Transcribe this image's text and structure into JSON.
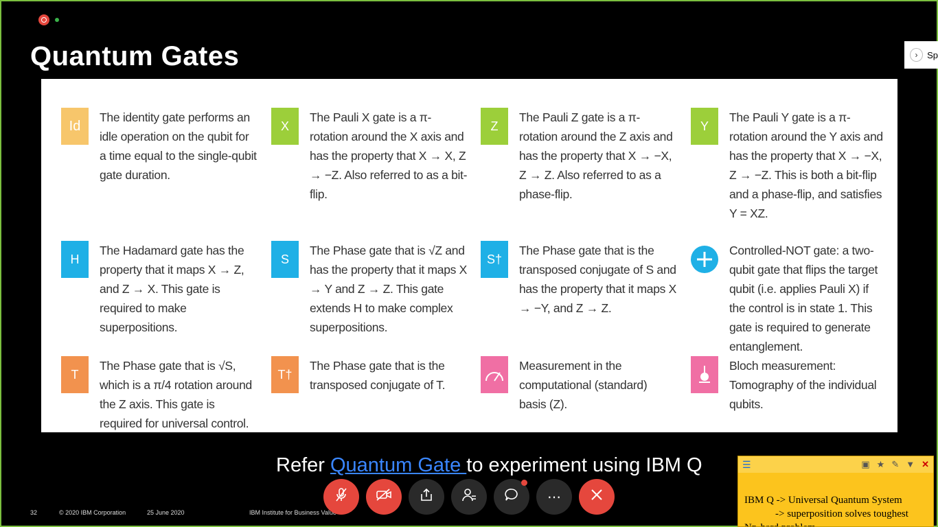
{
  "slide": {
    "title": "Quantum Gates",
    "refer_prefix": "Refer ",
    "refer_link": "Quantum Gate ",
    "refer_suffix": "to experiment using IBM Q",
    "footer": {
      "page": "32",
      "copyright": "© 2020 IBM Corporation",
      "date": "25 June 2020",
      "institute": "IBM Institute for Business Value"
    }
  },
  "side_panel": {
    "label": "Sp"
  },
  "gates": [
    {
      "symbol": "Id",
      "color": "#f7c66b",
      "desc": "The identity gate performs an idle operation on the qubit for a time equal to the single-qubit gate duration."
    },
    {
      "symbol": "X",
      "color": "#9ccf3a",
      "desc": "The Pauli X gate is a π-rotation around the X axis and has the property that X → X, Z → −Z. Also referred to as a bit-flip."
    },
    {
      "symbol": "Z",
      "color": "#9ccf3a",
      "desc": "The Pauli Z gate is a π-rotation around the Z axis and has the property that X → −X, Z → Z. Also referred to as a phase-flip."
    },
    {
      "symbol": "Y",
      "color": "#9ccf3a",
      "desc": "The Pauli Y gate is a π-rotation around the Y axis and has the property that X → −X, Z → −Z. This is both a bit-flip and a phase-flip, and satisfies Y = XZ."
    },
    {
      "symbol": "H",
      "color": "#1fb0e6",
      "desc": "The Hadamard gate has the property that it maps X → Z, and Z → X. This gate is required to make superpositions."
    },
    {
      "symbol": "S",
      "color": "#1fb0e6",
      "desc": "The Phase gate that is √Z and has the property that it maps X → Y and Z → Z. This gate extends H to make complex superpositions."
    },
    {
      "symbol": "S†",
      "color": "#1fb0e6",
      "desc": "The Phase gate that is the transposed conjugate of S and has the property that it maps X → −Y, and Z → Z."
    },
    {
      "symbol": "+",
      "color": "#1fb0e6",
      "desc": "Controlled-NOT gate: a two-qubit gate that flips the target qubit (i.e. applies Pauli X) if the control is in state 1. This gate is required to generate entanglement."
    },
    {
      "symbol": "T",
      "color": "#f2924e",
      "desc": "The Phase gate that is √S, which is a π/4 rotation around the Z axis. This gate is required for universal control."
    },
    {
      "symbol": "T†",
      "color": "#f2924e",
      "desc": "The Phase gate that is the transposed conjugate of T."
    },
    {
      "symbol": "meter",
      "color": "#f06fa4",
      "desc": "Measurement in the computational (standard) basis (Z)."
    },
    {
      "symbol": "bloch",
      "color": "#f06fa4",
      "desc": "Bloch measurement: Tomography of the individual qubits."
    }
  ],
  "controls": [
    {
      "name": "mute-button",
      "icon": "mic-off-icon",
      "style": "red"
    },
    {
      "name": "video-button",
      "icon": "video-off-icon",
      "style": "red"
    },
    {
      "name": "share-button",
      "icon": "share-icon",
      "style": "dark"
    },
    {
      "name": "participants-button",
      "icon": "participants-icon",
      "style": "dark"
    },
    {
      "name": "chat-button",
      "icon": "chat-icon",
      "style": "dark"
    },
    {
      "name": "more-button",
      "icon": "more-icon",
      "style": "dark"
    },
    {
      "name": "leave-button",
      "icon": "close-icon",
      "style": "red"
    }
  ],
  "sticky_note": {
    "text": "IBM Q -> Universal Quantum System\n            -> superposition solves toughest\nNp-hard problem"
  }
}
